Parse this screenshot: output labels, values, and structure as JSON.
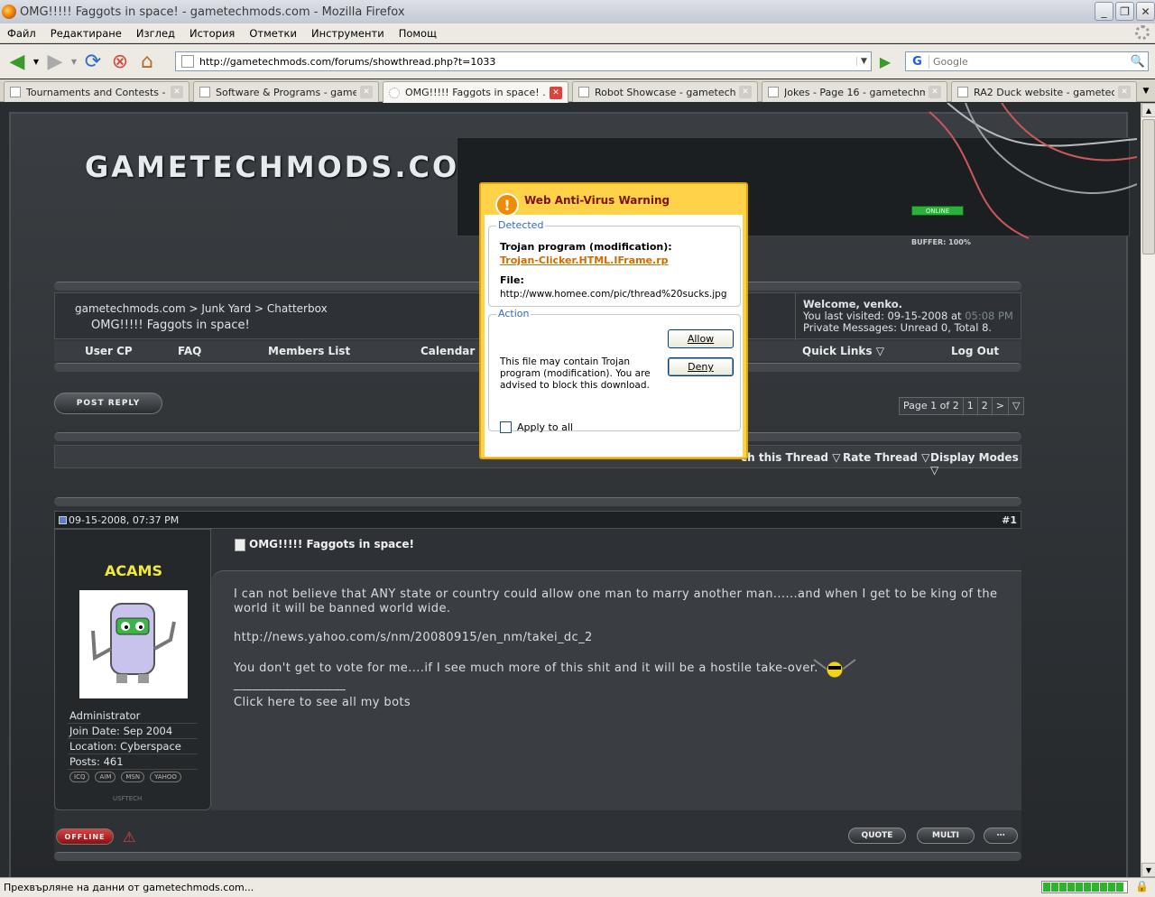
{
  "window": {
    "title": "OMG!!!!! Faggots in space! - gametechmods.com - Mozilla Firefox"
  },
  "menu": [
    "Файл",
    "Редактиране",
    "Изглед",
    "История",
    "Отметки",
    "Инструменти",
    "Помощ"
  ],
  "navigation": {
    "url": "http://gametechmods.com/forums/showthread.php?t=1033",
    "search_placeholder": "Google",
    "search_engine_icon": "G"
  },
  "tabs": [
    {
      "label": "Tournaments and Contests - ...",
      "active": false
    },
    {
      "label": "Software & Programs - gamet...",
      "active": false
    },
    {
      "label": "OMG!!!!! Faggots in space! ...",
      "active": true
    },
    {
      "label": "Robot Showcase - gametech...",
      "active": false
    },
    {
      "label": "Jokes - Page 16 - gametechm...",
      "active": false
    },
    {
      "label": "RA2 Duck website - gametech...",
      "active": false
    }
  ],
  "site": {
    "logo": "GAMETECHMODS.COM",
    "online": "ONLINE",
    "buffer": "BUFFER: 100%",
    "usftech": "USFTECH"
  },
  "breadcrumb": {
    "path": "gametechmods.com > Junk Yard > Chatterbox",
    "thread_title": "OMG!!!!! Faggots in space!"
  },
  "welcome": {
    "line1": "Welcome, venko.",
    "line2_prefix": "You last visited: 09-15-2008 at ",
    "line2_time": "05:08 PM",
    "line3": "Private Messages: Unread 0, Total 8."
  },
  "navlinks": {
    "user_cp": "User CP",
    "faq": "FAQ",
    "members": "Members List",
    "calendar": "Calendar",
    "quick_links": "Quick Links",
    "logout": "Log Out"
  },
  "post_reply": "POST REPLY",
  "pager": {
    "label": "Page 1 of 2",
    "p1": "1",
    "p2": "2",
    "next": ">"
  },
  "thread_tools": {
    "search": "ch this Thread",
    "rate": "Rate Thread",
    "display": "Display Modes"
  },
  "post": {
    "date": "09-15-2008, 07:37 PM",
    "number": "#1",
    "title": "OMG!!!!! Faggots in space!",
    "line1": "I can not believe that ANY state or country could allow one man to marry another man......and when I get to be king of the",
    "line2": "world it will be banned world wide.",
    "link": "http://news.yahoo.com/s/nm/20080915/en_nm/takei_dc_2",
    "line3": "You don't get to vote for me....if I see much more of this shit and it will be a hostile take-over.",
    "sig_rule": "__________________",
    "sig": "Click here to see all my bots",
    "offline": "OFFLINE",
    "quote": "QUOTE",
    "multi": "MULTI"
  },
  "user": {
    "name": "ACAMS",
    "role": "Administrator",
    "join": "Join Date: Sep 2004",
    "location": "Location: Cyberspace",
    "posts": "Posts: 461",
    "badges": [
      "ICQ",
      "AIM",
      "MSN",
      "YAHOO"
    ]
  },
  "dialog": {
    "title": "Web Anti-Virus Warning",
    "detected_legend": "Detected",
    "detected_label": "Trojan program (modification):",
    "detected_name": "Trojan-Clicker.HTML.IFrame.rp",
    "file_label": "File:",
    "file_value": "http://www.homee.com/pic/thread%20sucks.jpg",
    "action_legend": "Action",
    "message": "This file may contain Trojan program (modification). You are advised to block this download.",
    "allow": "Allow",
    "deny": "Deny",
    "apply_all": "Apply to all"
  },
  "status": {
    "text": "Прехвърляне на данни от gametechmods.com..."
  }
}
